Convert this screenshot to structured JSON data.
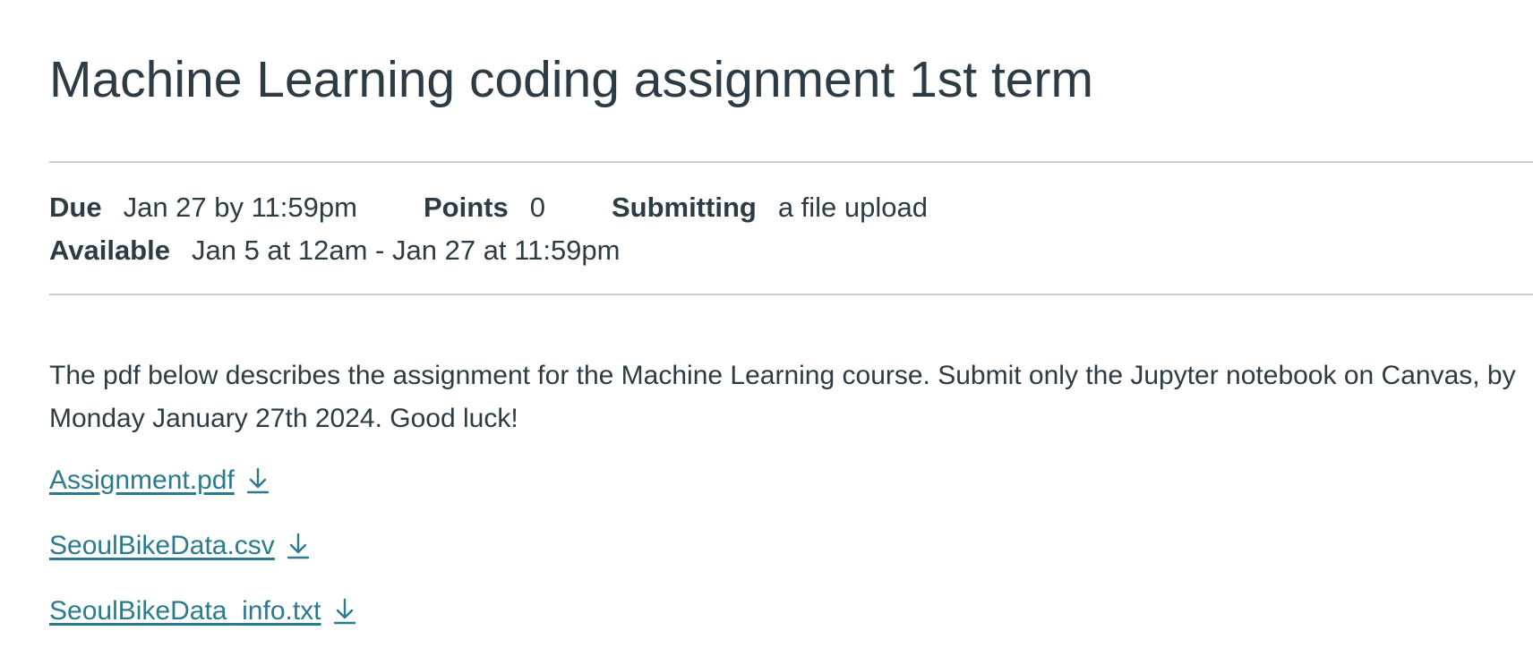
{
  "assignment": {
    "title": "Machine Learning coding assignment 1st term"
  },
  "details": {
    "due_label": "Due",
    "due_value": "Jan 27 by 11:59pm",
    "points_label": "Points",
    "points_value": "0",
    "submitting_label": "Submitting",
    "submitting_value": "a file upload",
    "available_label": "Available",
    "available_value": "Jan 5 at 12am - Jan 27 at 11:59pm"
  },
  "description": "The pdf below describes the assignment for the Machine Learning course. Submit only the Jupyter notebook on Canvas, by Monday January 27th 2024. Good luck!",
  "files": [
    {
      "name": "Assignment.pdf",
      "icon": "download-icon"
    },
    {
      "name": "SeoulBikeData.csv",
      "icon": "download-icon"
    },
    {
      "name": "SeoulBikeData_info.txt",
      "icon": "download-icon"
    }
  ],
  "colors": {
    "text": "#2d3b45",
    "link": "#2b7a8e",
    "rule": "#c7cdd1"
  }
}
